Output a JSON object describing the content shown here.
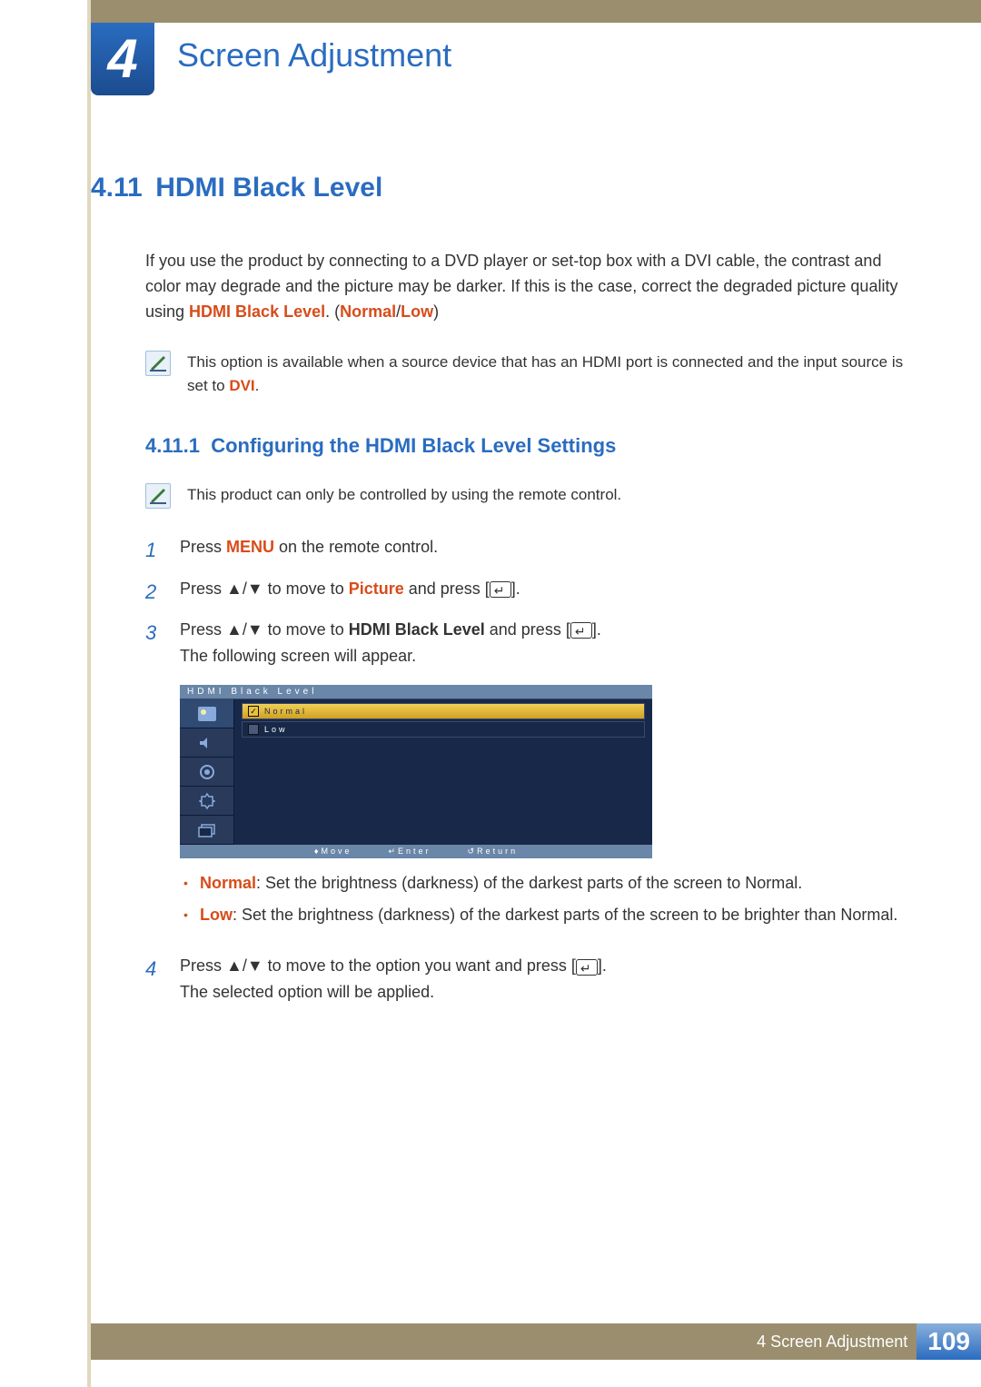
{
  "chapter": {
    "number": "4",
    "title": "Screen Adjustment"
  },
  "section": {
    "number": "4.11",
    "title": "HDMI Black Level"
  },
  "intro": {
    "p1a": "If you use the product by connecting to a DVD player or set-top box with a DVI cable, the contrast and color may degrade and the picture may be darker. If this is the case, correct the degraded picture quality using ",
    "bold1": "HDMI Black Level",
    "p1b": ". (",
    "bold2": "Normal",
    "p1c": "/",
    "bold3": "Low",
    "p1d": ")"
  },
  "note1": {
    "a": "This option is available when a source device that has an HDMI port is connected and the input source is set to ",
    "b": "DVI",
    "c": "."
  },
  "subsection": {
    "number": "4.11.1",
    "title": "Configuring the HDMI Black Level Settings"
  },
  "note2": "This product can only be controlled by using the remote control.",
  "steps": {
    "s1": {
      "n": "1",
      "a": "Press ",
      "b": "MENU",
      "c": " on the remote control."
    },
    "s2": {
      "n": "2",
      "a": "Press ",
      "arrows": "▲/▼",
      "b": " to move to ",
      "c": "Picture",
      "d": " and press [",
      "e": "]."
    },
    "s3": {
      "n": "3",
      "a": "Press ",
      "arrows": "▲/▼",
      "b": " to move to ",
      "c": "HDMI Black Level",
      "d": " and press [",
      "e": "].",
      "f": "The following screen will appear."
    },
    "s4": {
      "n": "4",
      "a": "Press ",
      "arrows": "▲/▼",
      "b": " to move to the option you want and press [",
      "c": "].",
      "d": "The selected option will be applied."
    }
  },
  "osd": {
    "title": "HDMI Black Level",
    "opt1": "Normal",
    "opt2": "Low",
    "footer": {
      "move": "Move",
      "enter": "Enter",
      "return": "Return"
    }
  },
  "bullets": {
    "b1a": "Normal",
    "b1b": ": Set the brightness (darkness) of the darkest parts of the screen to Normal.",
    "b2a": "Low",
    "b2b": ": Set the brightness (darkness) of the darkest parts of the screen to be brighter than Normal."
  },
  "footer": {
    "chapter_label": "4 Screen Adjustment",
    "page": "109"
  }
}
